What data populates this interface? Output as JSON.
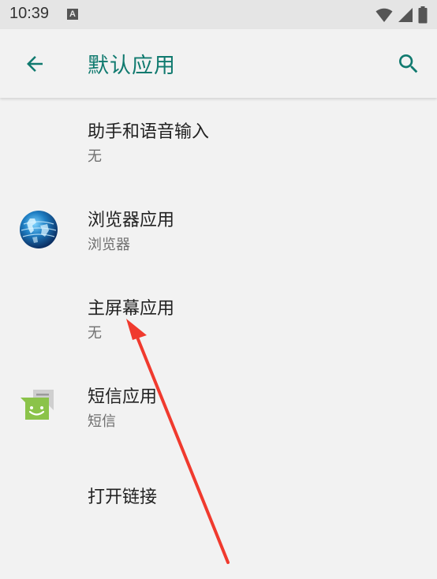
{
  "status_bar": {
    "time": "10:39",
    "notification_icon": "a-letter-icon",
    "icons": [
      "wifi-icon",
      "signal-icon",
      "battery-icon"
    ]
  },
  "app_bar": {
    "title": "默认应用",
    "back_icon": "back-arrow-icon",
    "search_icon": "search-icon",
    "accent_color": "#107a6f"
  },
  "items": [
    {
      "title": "助手和语音输入",
      "summary": "无",
      "icon": null
    },
    {
      "title": "浏览器应用",
      "summary": "浏览器",
      "icon": "globe-icon"
    },
    {
      "title": "主屏幕应用",
      "summary": "无",
      "icon": null
    },
    {
      "title": "短信应用",
      "summary": "短信",
      "icon": "sms-icon"
    },
    {
      "title": "打开链接",
      "summary": "",
      "icon": null
    }
  ],
  "annotation": {
    "type": "red-arrow",
    "color": "#f03a2e"
  }
}
